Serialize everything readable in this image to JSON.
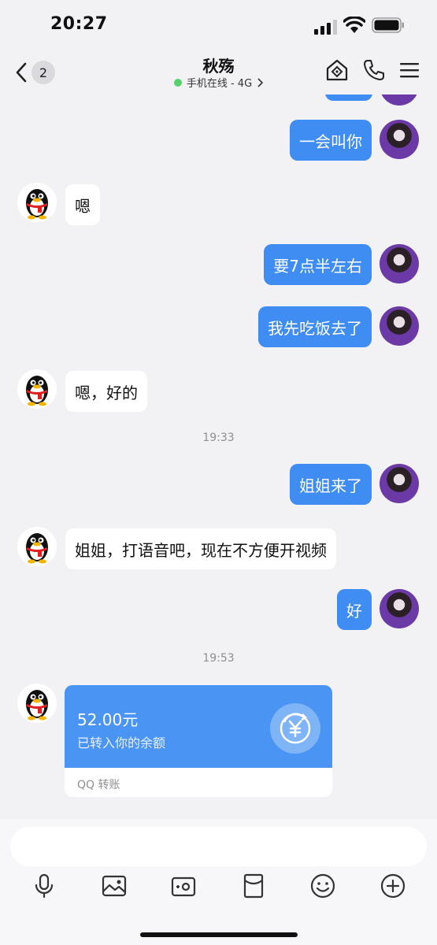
{
  "status_bar": {
    "time": "20:27"
  },
  "header": {
    "back_count": "2",
    "contact_name": "秋殇",
    "online_status": "手机在线 - 4G"
  },
  "messages": [
    {
      "side": "out",
      "text": "一会叫你"
    },
    {
      "side": "in",
      "text": "嗯"
    },
    {
      "side": "out",
      "text": "要7点半左右"
    },
    {
      "side": "out",
      "text": "我先吃饭去了"
    },
    {
      "side": "in",
      "text": "嗯，好的"
    },
    {
      "side": "time",
      "text": "19:33"
    },
    {
      "side": "out",
      "text": "姐姐来了"
    },
    {
      "side": "in",
      "text": "姐姐，打语音吧，现在不方便开视频"
    },
    {
      "side": "out",
      "text": "好"
    },
    {
      "side": "time",
      "text": "19:53"
    }
  ],
  "transfer": {
    "amount": "52.00元",
    "description": "已转入你的余额",
    "footer": "QQ 转账"
  },
  "input": {
    "placeholder": ""
  },
  "toolbar": [
    "microphone-icon",
    "image-icon",
    "camera-icon",
    "red-packet-icon",
    "emoji-icon",
    "plus-icon"
  ],
  "colors": {
    "outgoing_bubble": "#3f8cf3",
    "transfer_card": "#4a95f3",
    "online_dot": "#56d16b"
  }
}
